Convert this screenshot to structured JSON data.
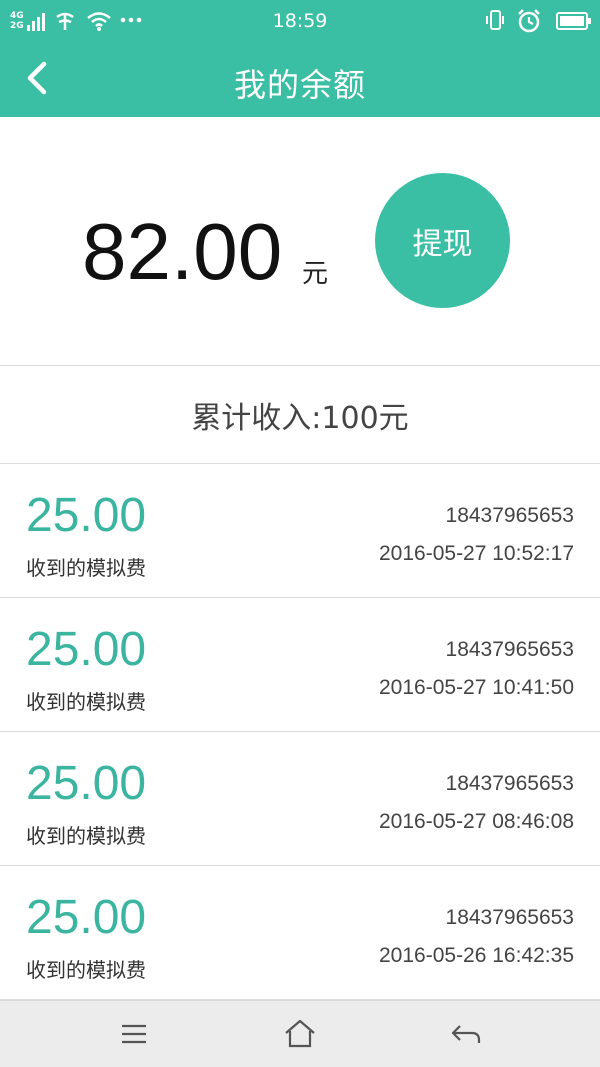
{
  "status_bar": {
    "network_top": "4G",
    "network_bottom": "2G",
    "time": "18:59",
    "icons": [
      "signal-icon",
      "carrier-icon",
      "wifi-icon",
      "more-dots-icon",
      "vibrate-icon",
      "alarm-icon",
      "battery-icon"
    ]
  },
  "header": {
    "title": "我的余额",
    "back_icon": "chevron-left-icon"
  },
  "balance": {
    "amount": "82.00",
    "unit": "元",
    "withdraw_label": "提现"
  },
  "total_income": "累计收入:100元",
  "transactions": [
    {
      "amount": "25.00",
      "desc": "收到的模拟费",
      "phone": "18437965653",
      "time": "2016-05-27 10:52:17"
    },
    {
      "amount": "25.00",
      "desc": "收到的模拟费",
      "phone": "18437965653",
      "time": "2016-05-27 10:41:50"
    },
    {
      "amount": "25.00",
      "desc": "收到的模拟费",
      "phone": "18437965653",
      "time": "2016-05-27 08:46:08"
    },
    {
      "amount": "25.00",
      "desc": "收到的模拟费",
      "phone": "18437965653",
      "time": "2016-05-26 16:42:35"
    }
  ],
  "nav_bar": {
    "icons": [
      "menu-icon",
      "home-icon",
      "back-arrow-icon"
    ]
  },
  "colors": {
    "accent": "#3bbfa4",
    "amount_text": "#3bb5a0"
  }
}
